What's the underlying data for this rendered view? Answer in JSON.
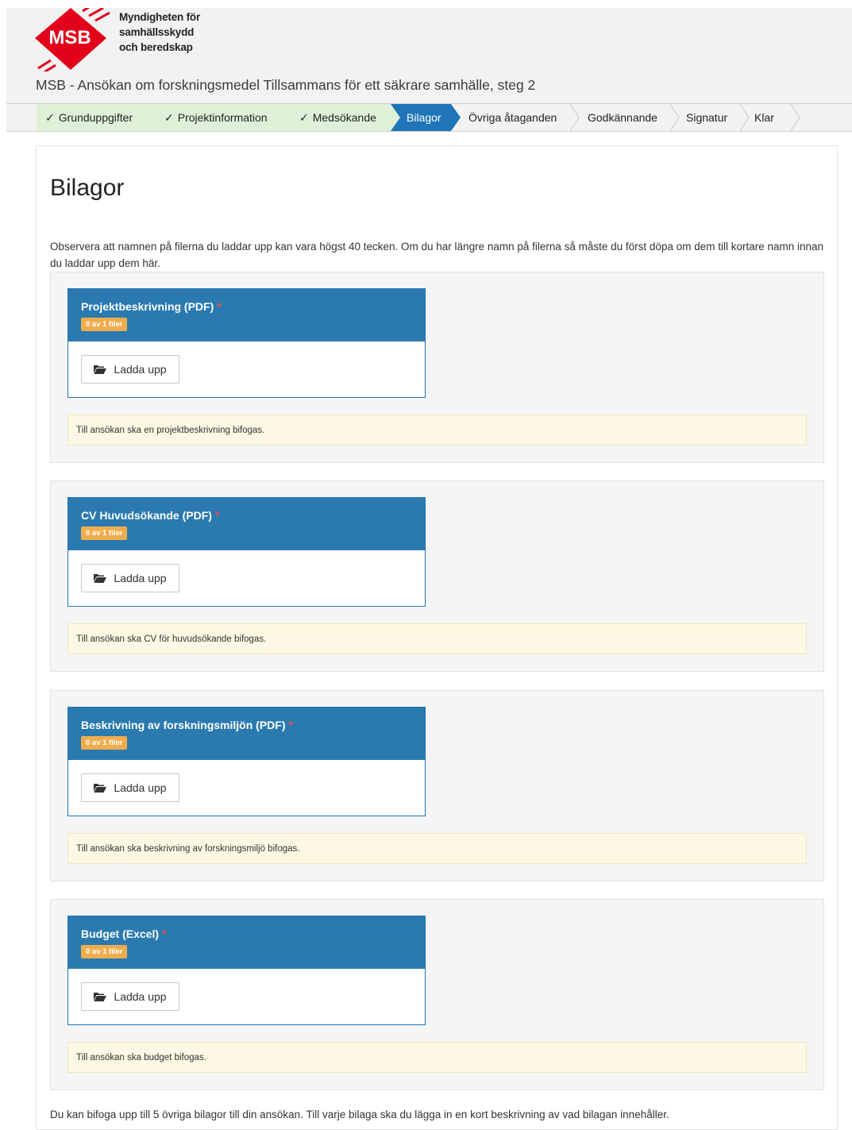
{
  "brand": {
    "logo_text": "MSB",
    "agency_lines": [
      "Myndigheten för",
      "samhällsskydd",
      "och beredskap"
    ],
    "colors": {
      "logo_red": "#e2001a",
      "primary_blue": "#1f75b7",
      "done_green": "#dff0d8",
      "badge_orange": "#f0ad4e",
      "required_red": "#d9534f",
      "note_yellow": "#fcf8e3"
    }
  },
  "header": {
    "title": "MSB - Ansökan om forskningsmedel Tillsammans för ett säkrare samhälle, steg 2"
  },
  "steps": [
    {
      "label": "Grunduppgifter",
      "status": "done",
      "icon": "check-icon"
    },
    {
      "label": "Projektinformation",
      "status": "done",
      "icon": "check-icon"
    },
    {
      "label": "Medsökande",
      "status": "done",
      "icon": "check-icon"
    },
    {
      "label": "Bilagor",
      "status": "active"
    },
    {
      "label": "Övriga åtaganden",
      "status": "pending"
    },
    {
      "label": "Godkännande",
      "status": "pending"
    },
    {
      "label": "Signatur",
      "status": "pending"
    },
    {
      "label": "Klar",
      "status": "pending"
    }
  ],
  "page": {
    "heading": "Bilagor",
    "intro": "Observera att namnen på filerna du laddar upp kan vara högst 40 tecken. Om du har längre namn på filerna så måste du först döpa om dem till kortare namn innan du laddar upp dem här."
  },
  "attachments": [
    {
      "title": "Projektbeskrivning (PDF)",
      "required_mark": "*",
      "badge": "0 av 1 filer",
      "upload_label": "Ladda upp",
      "note": "Till ansökan ska en projektbeskrivning bifogas."
    },
    {
      "title": "CV Huvudsökande (PDF)",
      "required_mark": "*",
      "badge": "0 av 1 filer",
      "upload_label": "Ladda upp",
      "note": "Till ansökan ska CV för huvudsökande bifogas."
    },
    {
      "title": "Beskrivning av forskningsmiljön (PDF)",
      "required_mark": "*",
      "badge": "0 av 1 filer",
      "upload_label": "Ladda upp",
      "note": "Till ansökan ska beskrivning av forskningsmiljö bifogas."
    },
    {
      "title": "Budget (Excel)",
      "required_mark": "*",
      "badge": "0 av 1 filer",
      "upload_label": "Ladda upp",
      "note": "Till ansökan ska budget bifogas."
    }
  ],
  "footer": {
    "text": "Du kan bifoga upp till 5 övriga bilagor till din ansökan. Till varje bilaga ska du lägga in en kort beskrivning av vad bilagan innehåller."
  }
}
